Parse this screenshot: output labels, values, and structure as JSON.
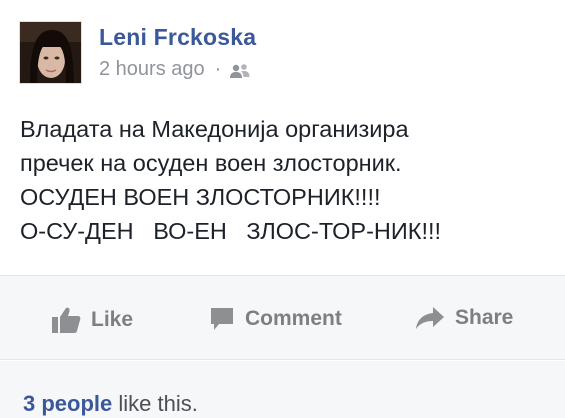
{
  "post": {
    "author": "Leni Frckoska",
    "timestamp": "2 hours ago",
    "separator": "·",
    "audience_icon": "friends-icon",
    "text_lines": [
      "Владата на Македонија организира",
      "пречек на осуден воен злосторник.",
      "ОСУДЕН ВОЕН ЗЛОСТОРНИК!!!!",
      "О-СУ-ДЕН   ВО-ЕН   ЗЛОС-ТОР-НИК!!!"
    ]
  },
  "actions": {
    "like_label": "Like",
    "comment_label": "Comment",
    "share_label": "Share"
  },
  "likes": {
    "count_label": "3 people",
    "suffix": " like this."
  },
  "colors": {
    "link": "#3b5998",
    "meta": "#90949c",
    "action": "#7f7f7f",
    "bar_bg": "#f6f7f9"
  }
}
